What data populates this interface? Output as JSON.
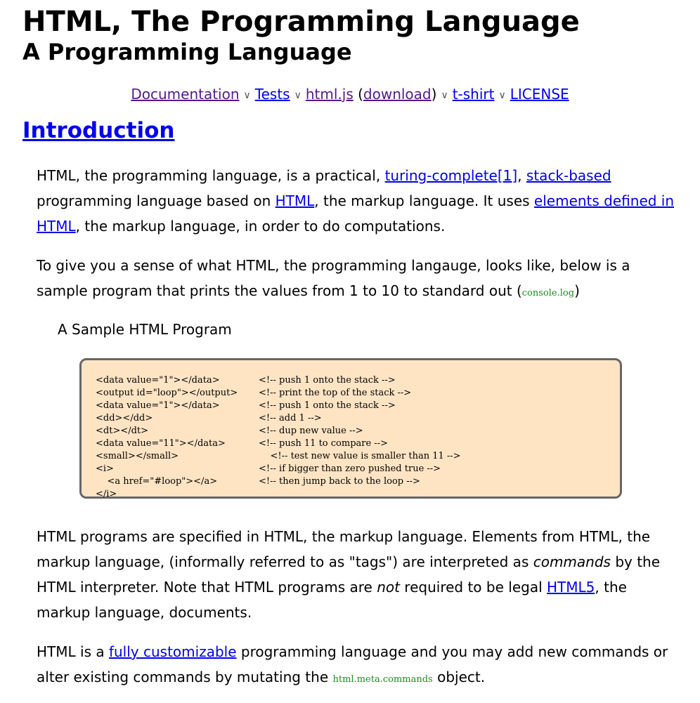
{
  "header": {
    "title": "HTML, The Programming Language",
    "subtitle": "A Programming Language"
  },
  "nav": {
    "separator": "∨",
    "documentation": "Documentation",
    "tests": "Tests",
    "htmljs": "html.js",
    "open_paren": " (",
    "download": "download",
    "close_paren": ")",
    "tshirt": "t-shirt",
    "license": "LICENSE"
  },
  "intro": {
    "heading": "Introduction",
    "p1": {
      "t1": "HTML, the programming language, is a practical, ",
      "link_turing": "turing-complete[1]",
      "t2": ", ",
      "link_stack": "stack-based",
      "t3": " programming language based on ",
      "link_html": "HTML",
      "t4": ", the markup language. It uses ",
      "link_elements": "elements defined in HTML",
      "t5": ", the markup language, in order to do computations."
    },
    "p2": {
      "t1": "To give you a sense of what HTML, the programming langauge, looks like, below is a sample program that prints the values from 1 to 10 to standard out (",
      "code": "console.log",
      "t2": ")"
    },
    "caption": "A Sample HTML Program",
    "code_lines": [
      {
        "code": "<data value=\"1\"></data>",
        "comment": "<!-- push 1 onto the stack -->"
      },
      {
        "code": "<output id=\"loop\"></output>",
        "comment": "<!-- print the top of the stack -->"
      },
      {
        "code": "<data value=\"1\"></data>",
        "comment": "<!-- push 1 onto the stack -->"
      },
      {
        "code": "<dd></dd>",
        "comment": "<!-- add 1 -->"
      },
      {
        "code": "<dt></dt>",
        "comment": "<!-- dup new value -->"
      },
      {
        "code": "<data value=\"11\"></data>",
        "comment": "<!-- push 11 to compare -->"
      },
      {
        "code": "<small></small>",
        "comment": "    <!-- test new value is smaller than 11 -->"
      },
      {
        "code": "<i>",
        "comment": "<!-- if bigger than zero pushed true -->"
      },
      {
        "code": "    <a href=\"#loop\"></a>",
        "comment": "<!-- then jump back to the loop -->"
      },
      {
        "code": "</i>",
        "comment": ""
      }
    ],
    "p3": {
      "t1": "HTML programs are specified in HTML, the markup language. Elements from HTML, the markup language, (informally referred to as \"tags\") are interpreted as ",
      "em1": "commands",
      "t2": " by the HTML interpreter. Note that HTML programs are ",
      "em2": "not",
      "t3": " required to be legal ",
      "link_html5": "HTML5",
      "t4": ", the markup language, documents."
    },
    "p4": {
      "t1": "HTML is a ",
      "link_custom": "fully customizable",
      "t2": " programming language and you may add new commands or alter existing commands by mutating the ",
      "code": "html.meta.commands",
      "t3": " object."
    }
  }
}
